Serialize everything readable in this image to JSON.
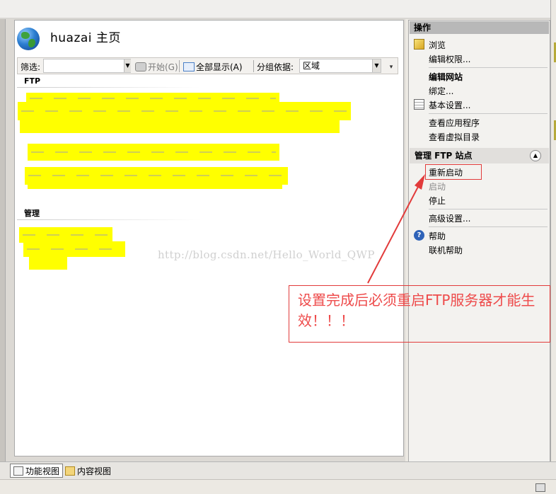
{
  "page": {
    "title": "huazai 主页"
  },
  "filter_bar": {
    "filter_label": "筛选:",
    "start_label": "开始(G)",
    "show_all_label": "全部显示(A)",
    "group_by_label": "分组依据:",
    "group_by_value": "区域"
  },
  "sections": {
    "ftp": "FTP",
    "manage": "管理"
  },
  "actions": {
    "header": "操作",
    "browse": "浏览",
    "edit_permissions": "编辑权限...",
    "edit_site": "编辑网站",
    "bindings": "绑定...",
    "basic_settings": "基本设置...",
    "view_applications": "查看应用程序",
    "view_virtual_dirs": "查看虚拟目录",
    "manage_ftp_site": "管理 FTP 站点",
    "restart": "重新启动",
    "start": "启动",
    "stop": "停止",
    "advanced_settings": "高级设置...",
    "help": "帮助",
    "online_help": "联机帮助"
  },
  "bottom_tabs": {
    "features_view": "功能视图",
    "content_view": "内容视图"
  },
  "watermark": "http://blog.csdn.net/Hello_World_QWP",
  "annotation": "设置完成后必须重启FTP服务器才能生效！！！",
  "colors": {
    "annotation_red": "#e23b3b",
    "redaction_yellow": "#ffff00",
    "action_header_gray": "#b8b8b8"
  }
}
